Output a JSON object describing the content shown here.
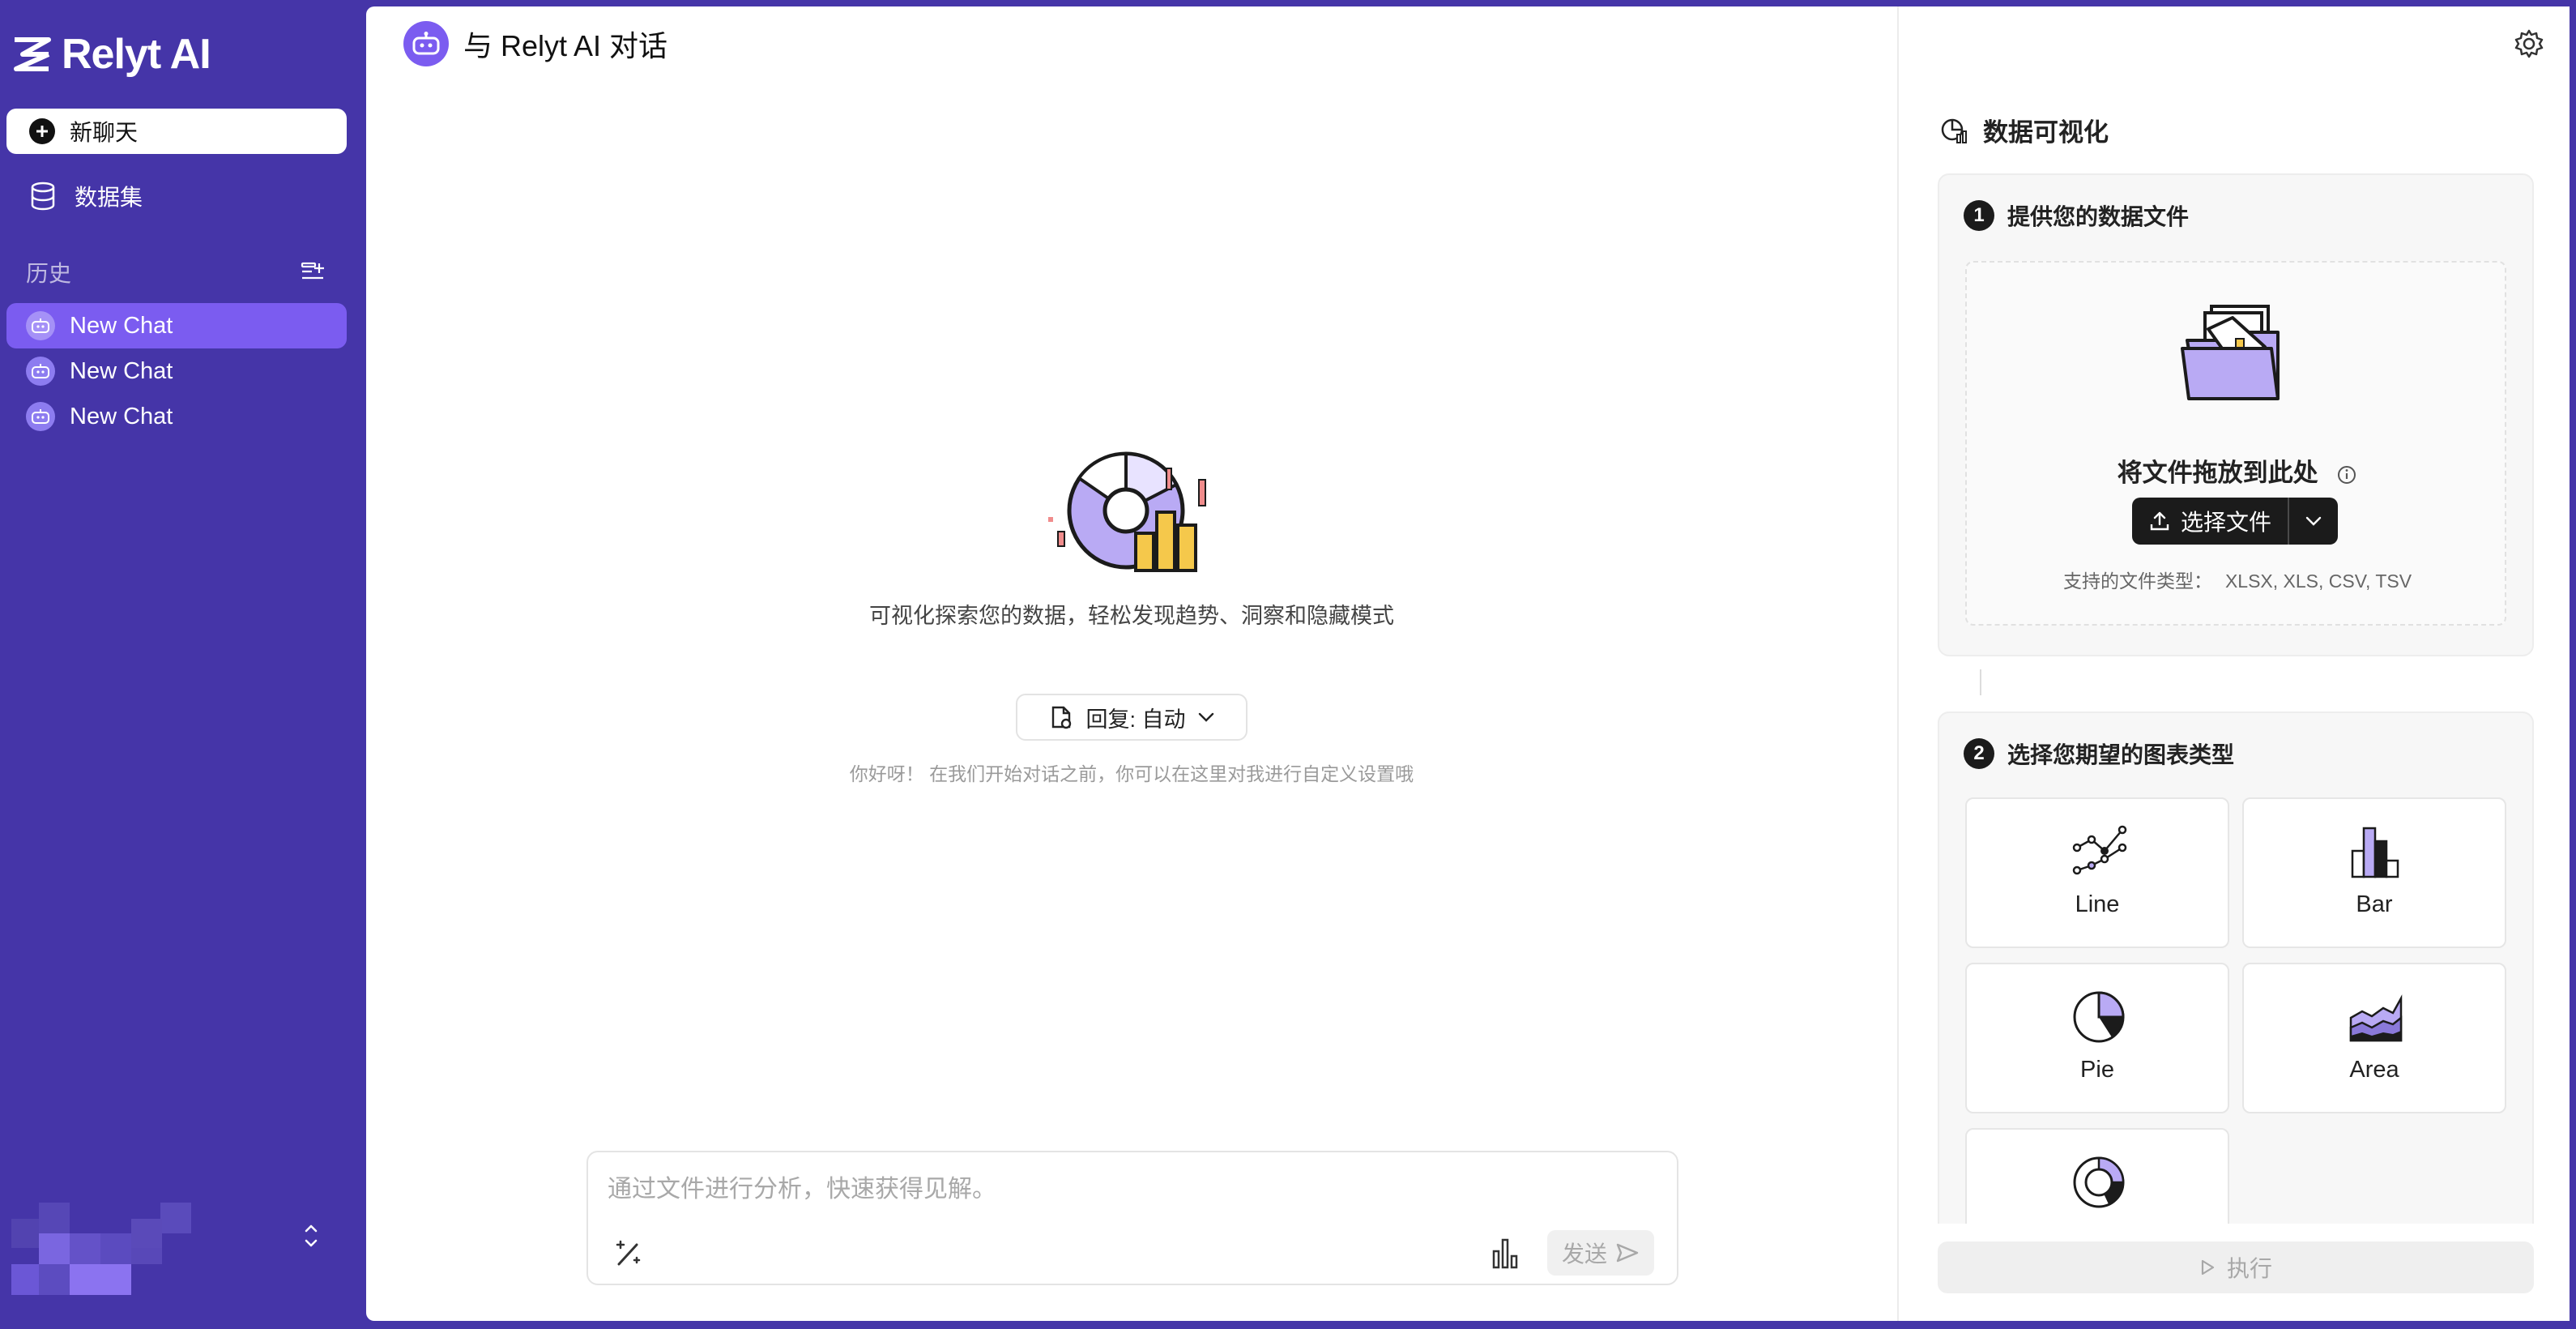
{
  "app": {
    "name": "Relyt AI"
  },
  "sidebar": {
    "new_chat_label": "新聊天",
    "dataset_label": "数据集",
    "history_label": "历史",
    "history": [
      {
        "label": "New Chat",
        "active": true
      },
      {
        "label": "New Chat",
        "active": false
      },
      {
        "label": "New Chat",
        "active": false
      }
    ]
  },
  "main": {
    "title": "与 Relyt AI 对话",
    "hero_text": "可视化探索您的数据，轻松发现趋势、洞察和隐藏模式",
    "reply_label": "回复: 自动",
    "reply_hint": "你好呀！ 在我们开始对话之前，你可以在这里对我进行自定义设置哦",
    "input_placeholder": "通过文件进行分析，快速获得见解。",
    "send_label": "发送"
  },
  "panel": {
    "title": "数据可视化",
    "step1": {
      "number": "1",
      "title": "提供您的数据文件",
      "drop_title": "将文件拖放到此处",
      "choose_label": "选择文件",
      "supported_label": "支持的文件类型：",
      "supported_types": "XLSX, XLS, CSV, TSV"
    },
    "step2": {
      "number": "2",
      "title": "选择您期望的图表类型",
      "chart_types": [
        {
          "label": "Line",
          "icon": "line-chart-icon"
        },
        {
          "label": "Bar",
          "icon": "bar-chart-icon"
        },
        {
          "label": "Pie",
          "icon": "pie-chart-icon"
        },
        {
          "label": "Area",
          "icon": "area-chart-icon"
        },
        {
          "label": "",
          "icon": "donut-chart-icon"
        }
      ]
    },
    "run_label": "执行"
  },
  "colors": {
    "sidebar_bg": "#4535a8",
    "accent": "#7b5cf0",
    "accent_light": "#b7a8f5",
    "highlight_yellow": "#f5c84b"
  }
}
